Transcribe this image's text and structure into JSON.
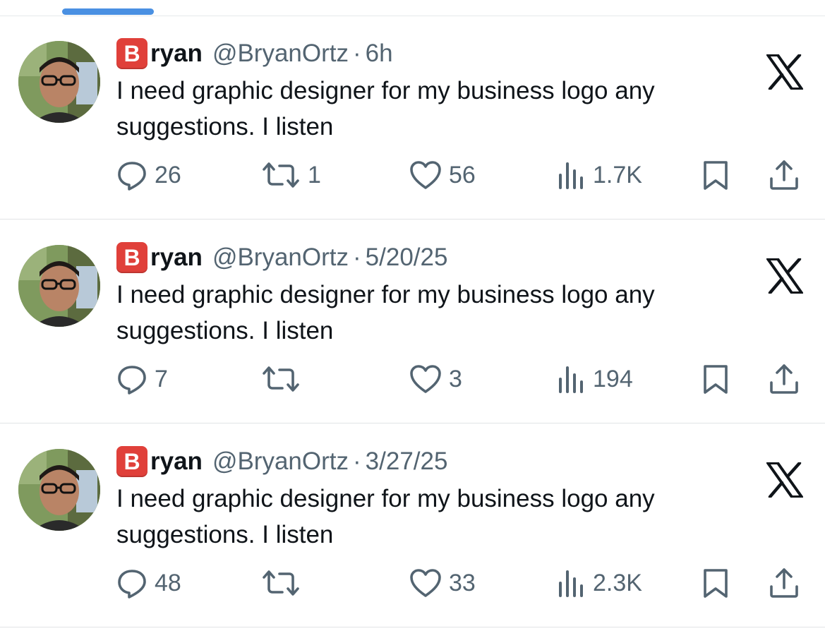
{
  "tweets": [
    {
      "badge": "B",
      "name": "ryan",
      "handle": "@BryanOrtz",
      "separator": "·",
      "time": "6h",
      "text": "I need graphic designer for my business logo any suggestions. I listen",
      "replies": "26",
      "retweets": "1",
      "likes": "56",
      "views": "1.7K"
    },
    {
      "badge": "B",
      "name": "ryan",
      "handle": "@BryanOrtz",
      "separator": "·",
      "time": "5/20/25",
      "text": "I need graphic designer for my business logo any suggestions. I listen",
      "replies": "7",
      "retweets": "",
      "likes": "3",
      "views": "194"
    },
    {
      "badge": "B",
      "name": "ryan",
      "handle": "@BryanOrtz",
      "separator": "·",
      "time": "3/27/25",
      "text": "I need graphic designer for my business logo any suggestions. I listen",
      "replies": "48",
      "retweets": "",
      "likes": "33",
      "views": "2.3K"
    }
  ],
  "icons": {
    "reply": "reply-icon",
    "retweet": "retweet-icon",
    "like": "heart-icon",
    "views": "views-icon",
    "bookmark": "bookmark-icon",
    "share": "share-icon",
    "platform": "x-logo-icon"
  },
  "colors": {
    "text": "#0f1419",
    "secondary": "#536471",
    "badge": "#e0403a",
    "tab_indicator": "#4a90e2"
  }
}
